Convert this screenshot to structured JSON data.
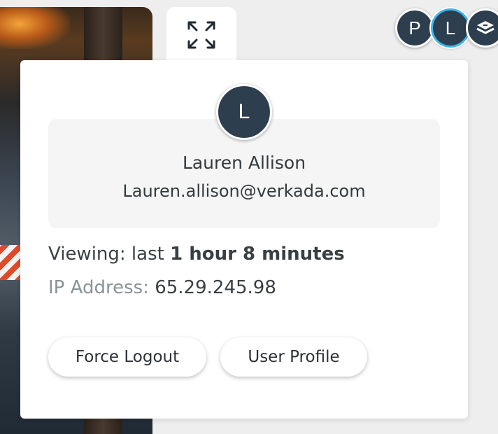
{
  "camera": {
    "icon": "camera-feed-image"
  },
  "expand": {
    "icon": "expand-arrows-icon"
  },
  "avatars": [
    {
      "initial": "P",
      "active": false
    },
    {
      "initial": "L",
      "active": true
    },
    {
      "initial": "",
      "icon": "layers-icon",
      "active": false
    }
  ],
  "popover": {
    "avatar_initial": "L",
    "user_name": "Lauren Allison",
    "user_email": "Lauren.allison@verkada.com",
    "viewing_prefix": "Viewing: last ",
    "viewing_duration": "1 hour 8 minutes",
    "ip_label": "IP Address:",
    "ip_value": "65.29.245.98",
    "force_logout_label": "Force Logout",
    "user_profile_label": "User Profile"
  },
  "colors": {
    "avatar_bg": "#2d3e4e",
    "active_ring": "#3fb4ea",
    "card_bg": "#ffffff",
    "info_box_bg": "#f5f5f5"
  }
}
